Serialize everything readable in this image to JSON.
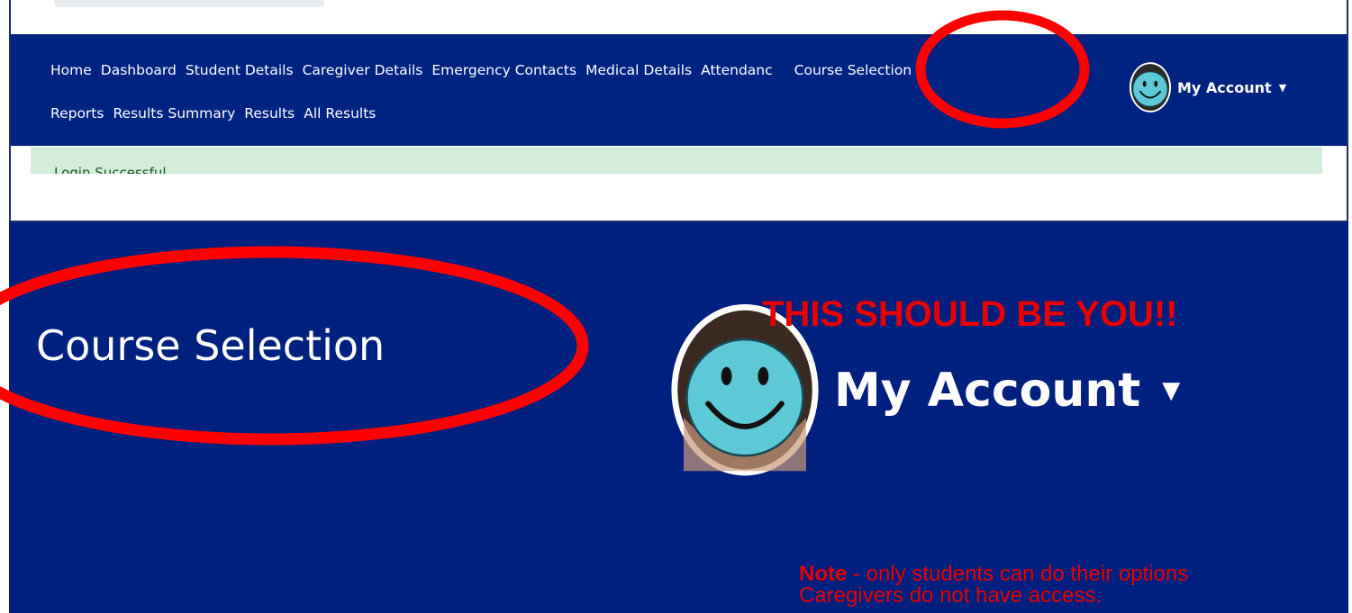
{
  "nav": {
    "row1": [
      "Home",
      "Dashboard",
      "Student Details",
      "Caregiver Details",
      "Emergency Contacts",
      "Medical Details",
      "Attendanc",
      "Course Selection"
    ],
    "row2": [
      "Reports",
      "Results Summary",
      "Results",
      "All Results"
    ]
  },
  "account": {
    "label": "My Account"
  },
  "alert": {
    "text": "Login Successful"
  },
  "zoom": {
    "title": "Course Selection",
    "account_label": "My Account"
  },
  "annotation": {
    "headline": "THIS SHOULD BE YOU!!",
    "note_bold": "Note",
    "note_rest": " - only students can do their options",
    "note_line2": "Caregivers do not have access."
  },
  "colors": {
    "navbar": "#002280",
    "zoom_bg": "#00207f",
    "annotation": "#e60000",
    "alert_bg": "#d4edda",
    "alert_text": "#155724"
  },
  "icons": [
    "smiley-avatar-icon",
    "caret-down-icon"
  ]
}
